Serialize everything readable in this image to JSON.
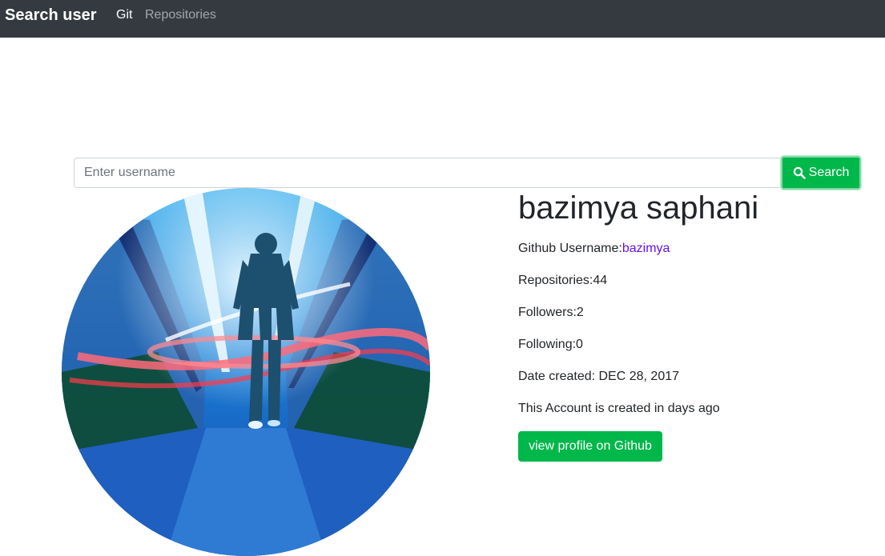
{
  "navbar": {
    "brand": "Search user",
    "links": [
      "Git",
      "Repositories"
    ]
  },
  "search": {
    "placeholder": "Enter username",
    "value": "",
    "button_label": "Search"
  },
  "profile": {
    "name": "bazimya saphani",
    "username_label": "Github Username:",
    "username": "bazimya",
    "repositories_label": "Repositories:",
    "repositories": "44",
    "followers_label": "Followers:",
    "followers": "2",
    "following_label": "Following:",
    "following": "0",
    "date_label": "Date created: ",
    "date_created": "DEC 28, 2017",
    "account_age_text": "This Account is created in days ago",
    "github_button": "view profile on Github"
  },
  "colors": {
    "navbar_bg": "#343a40",
    "accent_green": "#00b74a",
    "link_purple": "#6610f2"
  }
}
